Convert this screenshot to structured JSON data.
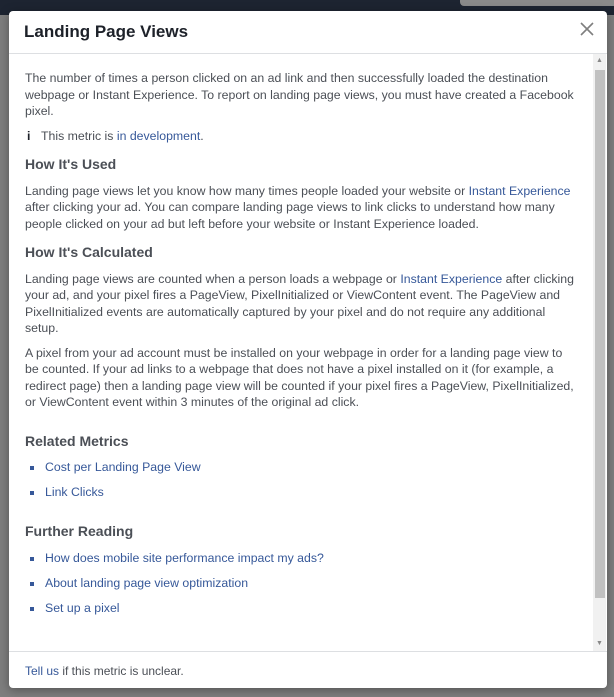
{
  "dialog": {
    "title": "Landing Page Views",
    "close_icon": "close-x-icon",
    "intro": "The number of times a person clicked on an ad link and then successfully loaded the destination webpage or Instant Experience. To report on landing page views, you must have created a Facebook pixel.",
    "info": {
      "icon": "info-icon",
      "prefix": "This metric is ",
      "link": "in development",
      "suffix": "."
    },
    "how_used": {
      "heading": "How It's Used",
      "text_1": "Landing page views let you know how many times people loaded your website or ",
      "link": "Instant Experience",
      "text_2": " after clicking your ad. You can compare landing page views to link clicks to understand how many people clicked on your ad but left before your website or Instant Experience loaded."
    },
    "how_calculated": {
      "heading": "How It's Calculated",
      "p1_text_1": "Landing page views are counted when a person loads a webpage or ",
      "p1_link": "Instant Experience",
      "p1_text_2": " after clicking your ad, and your pixel fires a PageView, PixelInitialized or ViewContent event. The PageView and PixelInitialized events are automatically captured by your pixel and do not require any additional setup.",
      "p2": "A pixel from your ad account must be installed on your webpage in order for a landing page view to be counted. If your ad links to a webpage that does not have a pixel installed on it (for example, a redirect page) then a landing page view will be counted if your pixel fires a PageView, PixelInitialized, or ViewContent event within 3 minutes of the original ad click."
    },
    "related_metrics": {
      "heading": "Related Metrics",
      "items": [
        "Cost per Landing Page View",
        "Link Clicks"
      ]
    },
    "further_reading": {
      "heading": "Further Reading",
      "items": [
        "How does mobile site performance impact my ads?",
        "About landing page view optimization",
        "Set up a pixel"
      ]
    },
    "footer": {
      "link": "Tell us",
      "text": " if this metric is unclear."
    }
  },
  "colors": {
    "link": "#365899",
    "text": "#4b4f56",
    "overlay": "#7e7e7e"
  }
}
